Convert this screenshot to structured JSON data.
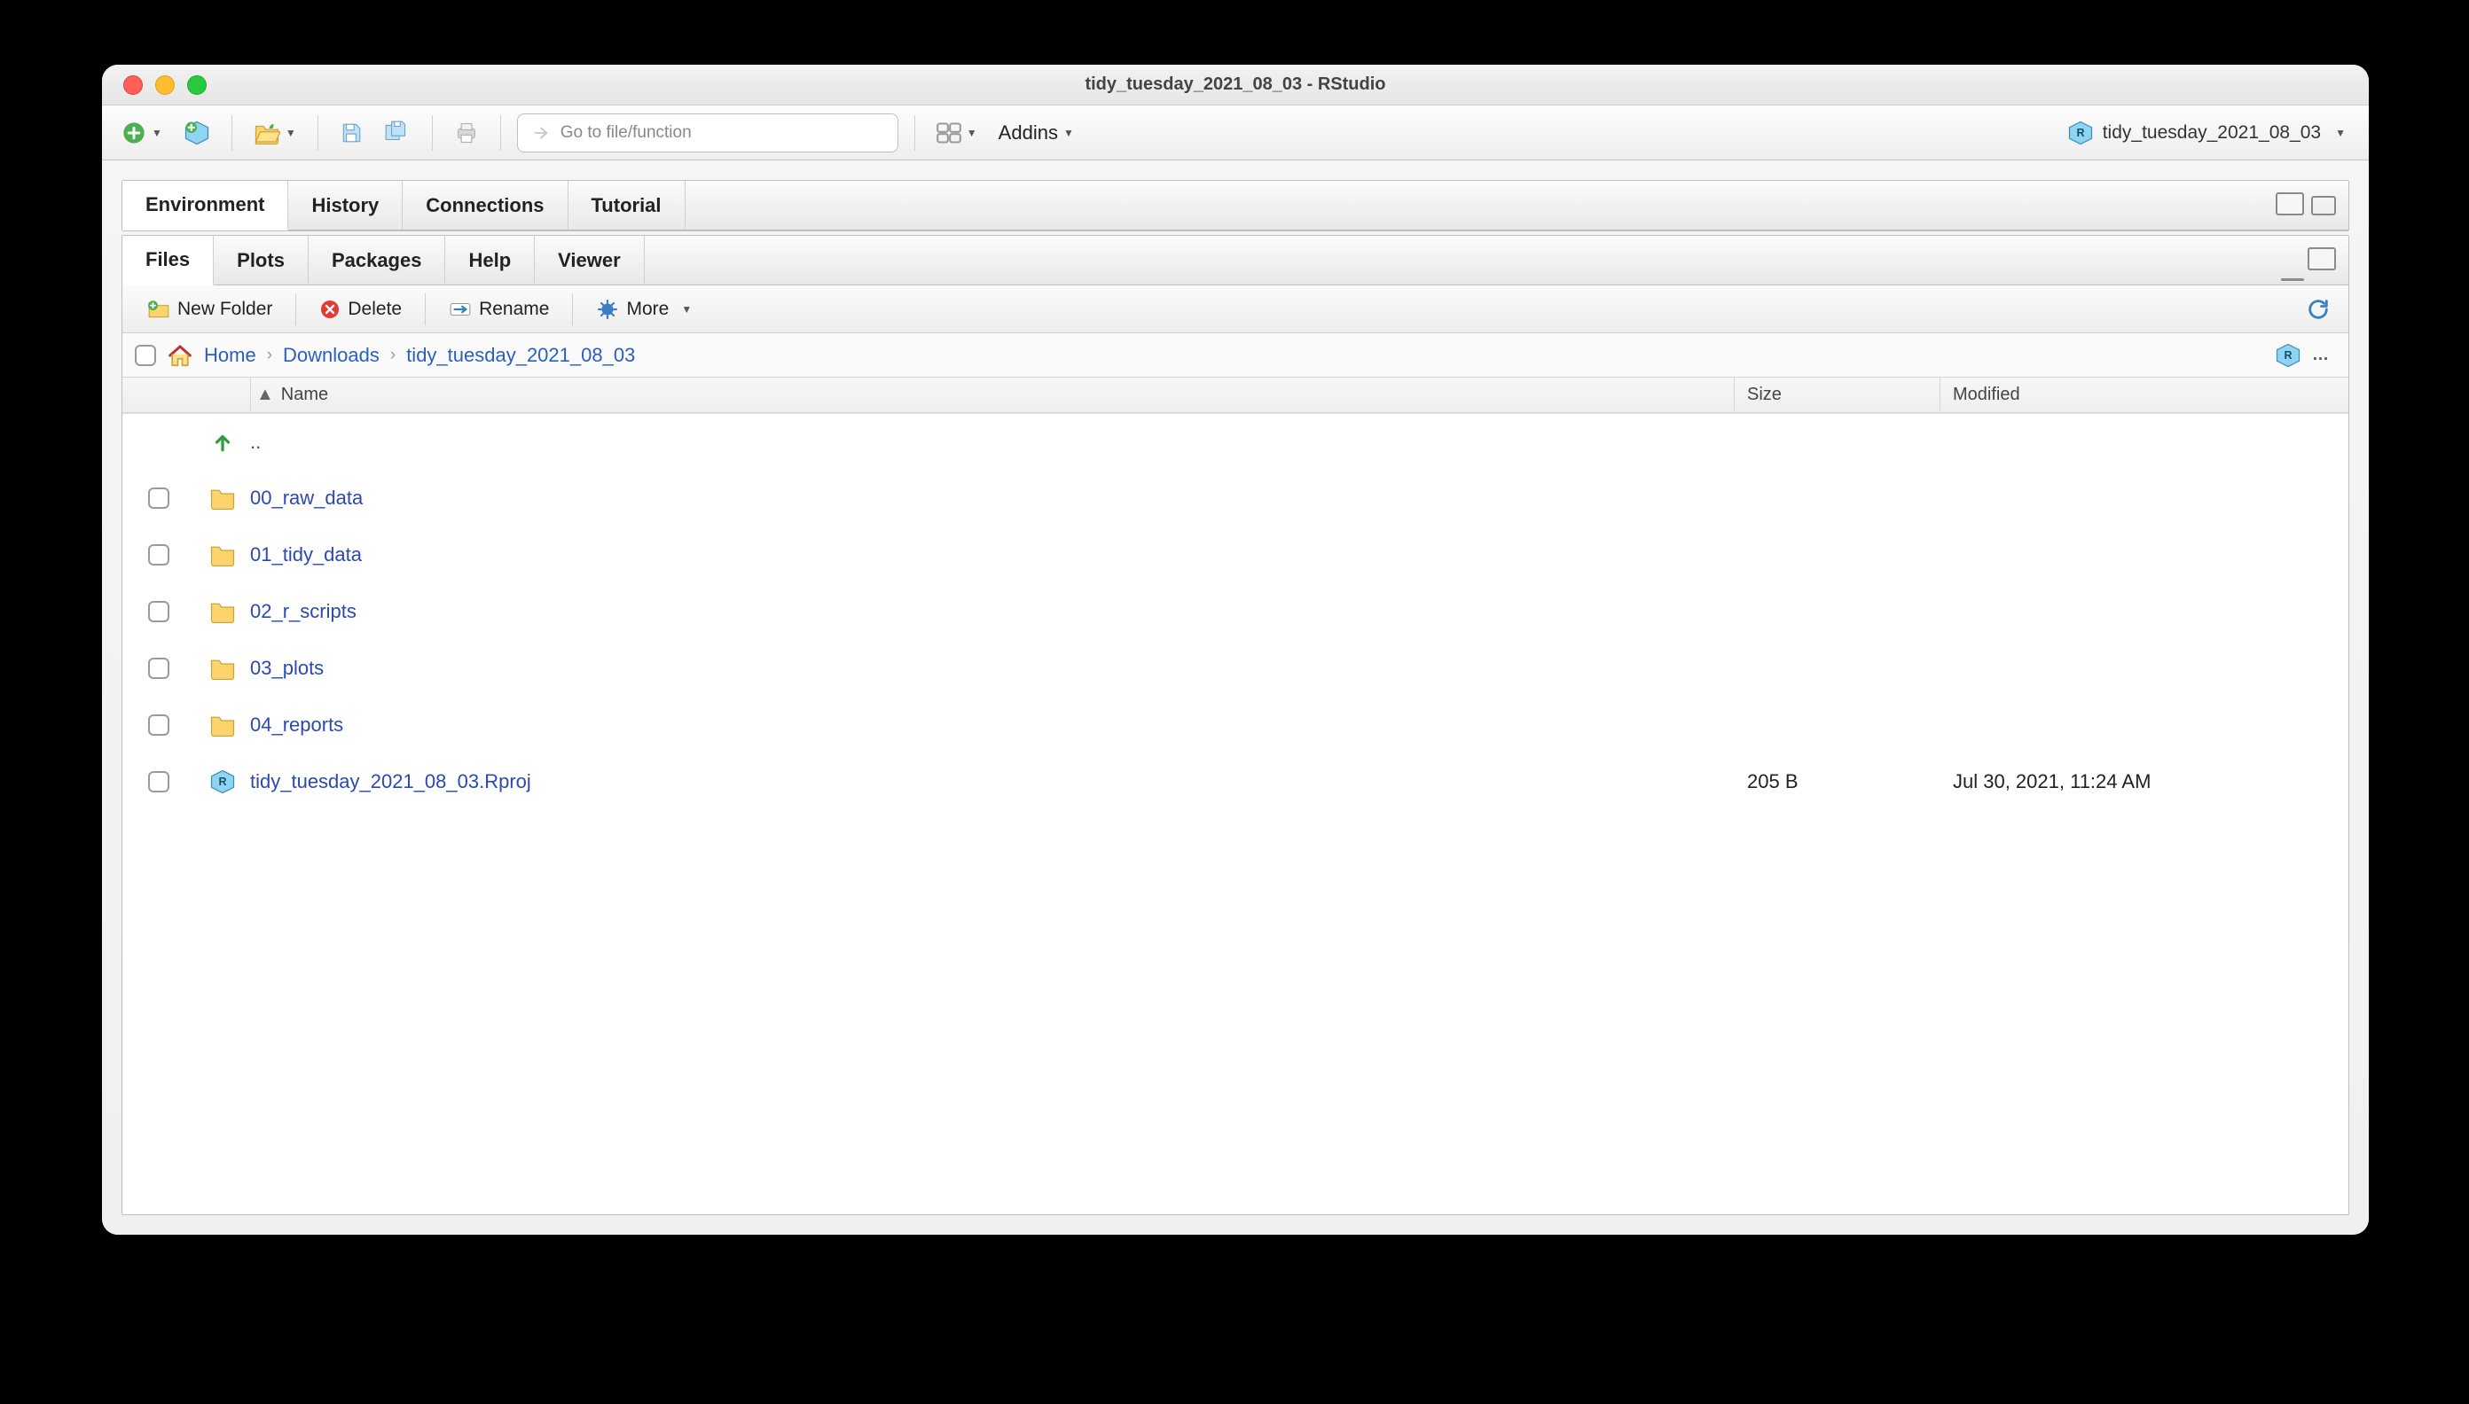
{
  "window": {
    "title": "tidy_tuesday_2021_08_03 - RStudio"
  },
  "project": {
    "name": "tidy_tuesday_2021_08_03"
  },
  "toolbar": {
    "search_placeholder": "Go to file/function",
    "addins_label": "Addins"
  },
  "env_tabs": [
    "Environment",
    "History",
    "Connections",
    "Tutorial"
  ],
  "files_tabs": [
    "Files",
    "Plots",
    "Packages",
    "Help",
    "Viewer"
  ],
  "files_toolbar": {
    "new_folder": "New Folder",
    "delete": "Delete",
    "rename": "Rename",
    "more": "More"
  },
  "breadcrumb": [
    "Home",
    "Downloads",
    "tidy_tuesday_2021_08_03"
  ],
  "columns": {
    "name": "Name",
    "size": "Size",
    "modified": "Modified"
  },
  "up_label": "..",
  "files": [
    {
      "type": "folder",
      "name": "00_raw_data",
      "size": "",
      "modified": ""
    },
    {
      "type": "folder",
      "name": "01_tidy_data",
      "size": "",
      "modified": ""
    },
    {
      "type": "folder",
      "name": "02_r_scripts",
      "size": "",
      "modified": ""
    },
    {
      "type": "folder",
      "name": "03_plots",
      "size": "",
      "modified": ""
    },
    {
      "type": "folder",
      "name": "04_reports",
      "size": "",
      "modified": ""
    },
    {
      "type": "rproj",
      "name": "tidy_tuesday_2021_08_03.Rproj",
      "size": "205 B",
      "modified": "Jul 30, 2021, 11:24 AM"
    }
  ]
}
